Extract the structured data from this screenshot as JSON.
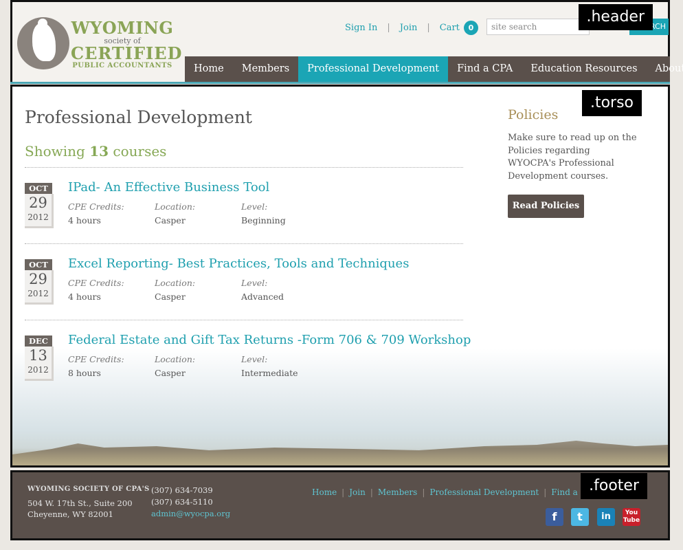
{
  "header": {
    "tag": ".header",
    "logo": {
      "line1": "WYOMING",
      "line2": "society of",
      "line3": "CERTIFIED",
      "line4": "PUBLIC ACCOUNTANTS"
    },
    "top_links": {
      "sign_in": "Sign In",
      "join": "Join",
      "cart": "Cart",
      "cart_count": "0",
      "sep": "|"
    },
    "search": {
      "placeholder": "site search",
      "button": "SEARCH"
    },
    "nav": [
      "Home",
      "Members",
      "Professional Development",
      "Find a CPA",
      "Education Resources",
      "About"
    ],
    "active_nav": "Professional Development",
    "accent_color": "#1ba5b5"
  },
  "torso": {
    "tag": ".torso",
    "page_title": "Professional Development",
    "showing": {
      "prefix": "Showing",
      "count": "13",
      "suffix": "courses"
    },
    "field_labels": {
      "credits": "CPE Credits:",
      "location": "Location:",
      "level": "Level:"
    },
    "courses": [
      {
        "month": "OCT",
        "day": "29",
        "year": "2012",
        "title": "IPad- An Effective Business Tool",
        "credits": "4 hours",
        "location": "Casper",
        "level": "Beginning"
      },
      {
        "month": "OCT",
        "day": "29",
        "year": "2012",
        "title": "Excel Reporting- Best Practices, Tools and Techniques",
        "credits": "4 hours",
        "location": "Casper",
        "level": "Advanced"
      },
      {
        "month": "DEC",
        "day": "13",
        "year": "2012",
        "title": "Federal Estate and Gift Tax Returns -Form 706 & 709 Workshop",
        "credits": "8 hours",
        "location": "Casper",
        "level": "Intermediate"
      }
    ],
    "policies": {
      "title": "Policies",
      "text": "Make sure to read up on the Policies regarding WYOCPA's Professional Development courses.",
      "button": "Read Policies"
    }
  },
  "footer": {
    "tag": ".footer",
    "org": "WYOMING SOCIETY OF CPA'S",
    "address1": "504 W. 17th St., Suite 200",
    "address2": "Cheyenne, WY 82001",
    "phone1": "(307) 634-7039",
    "phone2": "(307) 634-5110",
    "email": "admin@wyocpa.org",
    "links": [
      "Home",
      "Join",
      "Members",
      "Professional Development",
      "Find a CPA"
    ],
    "social": {
      "facebook": "f",
      "twitter": "t",
      "linkedin": "in",
      "youtube": "You Tube"
    }
  }
}
